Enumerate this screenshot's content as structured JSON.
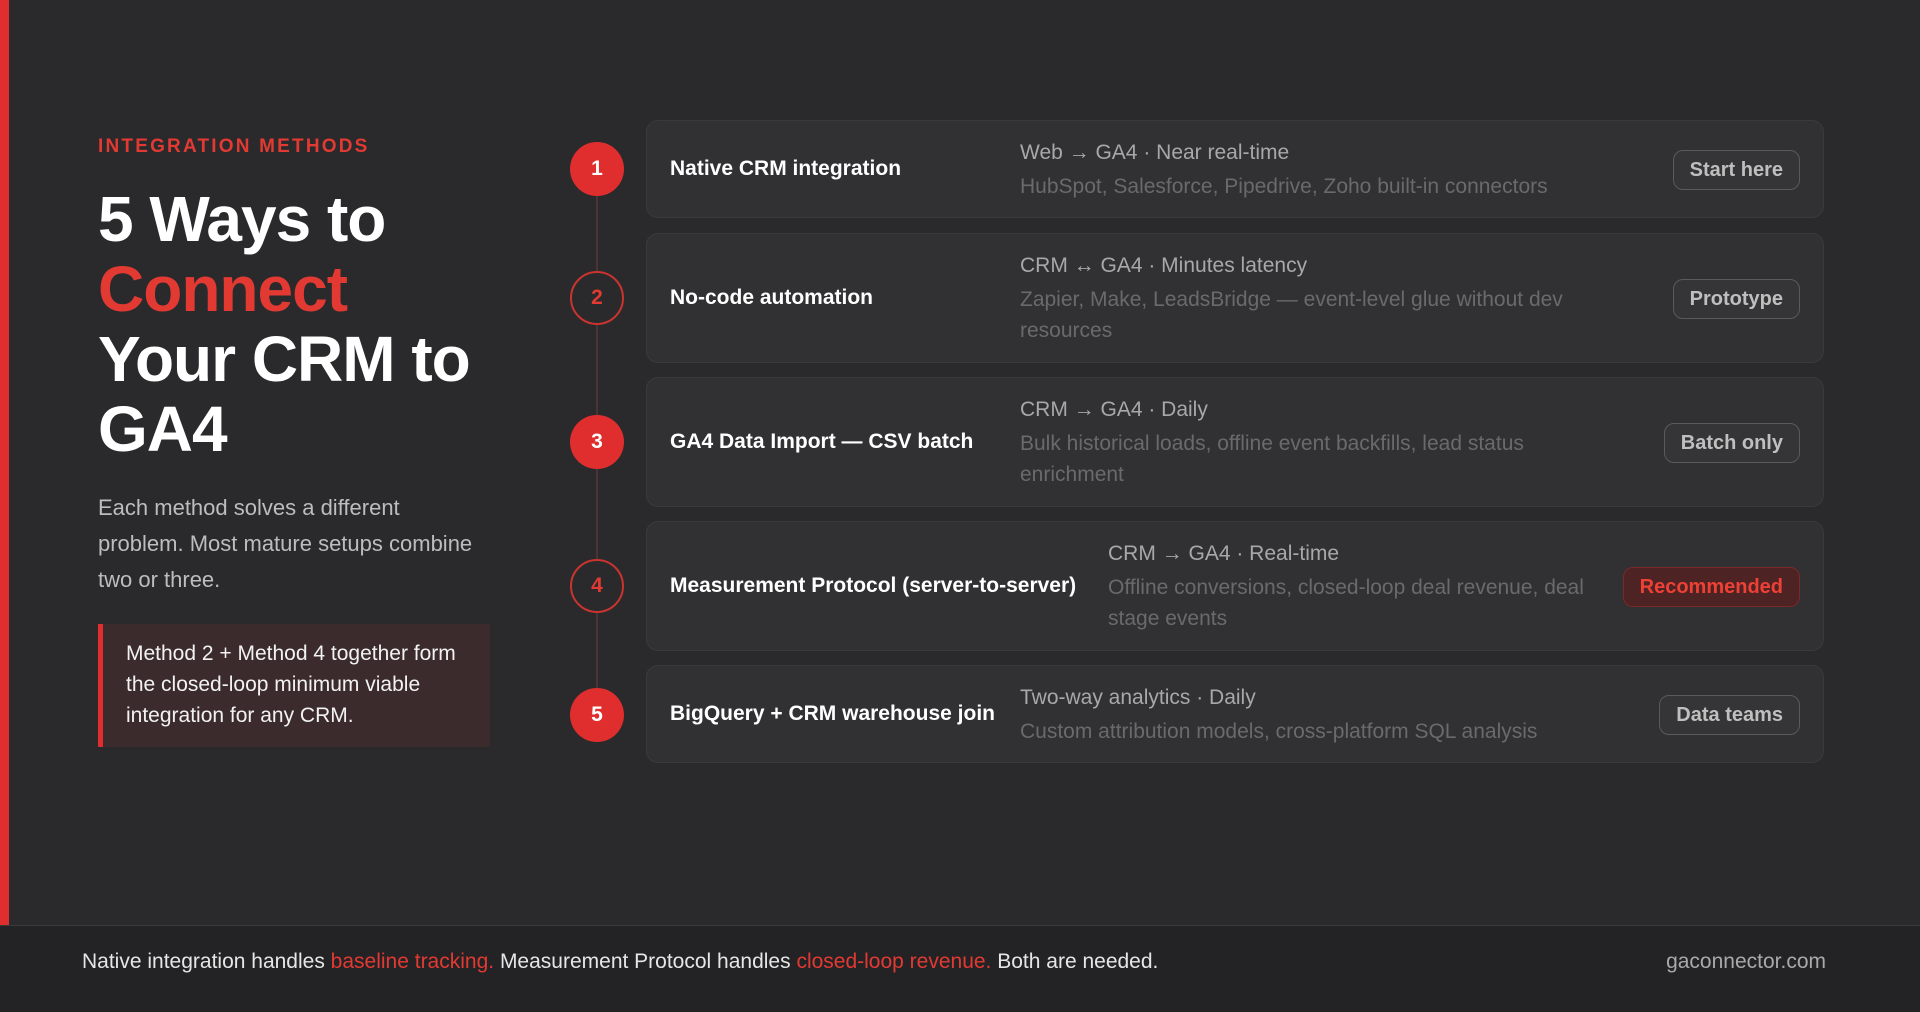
{
  "theme": {
    "accent": "#e02e2e",
    "background": "#2a2a2c",
    "card": "#313133"
  },
  "hero": {
    "eyebrow": "INTEGRATION METHODS",
    "title_line1": "5 Ways to",
    "title_line2": "Connect",
    "title_line3": "Your CRM to",
    "title_line4": "GA4",
    "description": "Each method solves a different problem. Most mature setups combine two or three.",
    "callout": "Method 2 + Method 4 together form the closed-loop minimum viable integration for any CRM."
  },
  "methods": [
    {
      "number": "1",
      "title": "Native CRM integration",
      "meta": "Web → GA4 · Near real-time",
      "description": "HubSpot, Salesforce, Pipedrive, Zoho built-in connectors",
      "tag": "Start here"
    },
    {
      "number": "2",
      "title": "No-code automation",
      "meta": "CRM ↔ GA4 · Minutes latency",
      "description": "Zapier, Make, LeadsBridge — event-level glue without dev resources",
      "tag": "Prototype"
    },
    {
      "number": "3",
      "title": "GA4 Data Import — CSV batch",
      "meta": "CRM → GA4 · Daily",
      "description": "Bulk historical loads, offline event backfills, lead status enrichment",
      "tag": "Batch only"
    },
    {
      "number": "4",
      "title": "Measurement Protocol (server-to-server)",
      "meta": "CRM → GA4 · Real-time",
      "description": "Offline conversions, closed-loop deal revenue, deal stage events",
      "tag": "Recommended"
    },
    {
      "number": "5",
      "title": "BigQuery + CRM warehouse join",
      "meta": "Two-way analytics · Daily",
      "description": "Custom attribution models, cross-platform SQL analysis",
      "tag": "Data teams"
    }
  ],
  "footer": {
    "part1": "Native integration handles ",
    "highlight1": "baseline tracking.",
    "part2": " Measurement Protocol handles ",
    "highlight2": "closed-loop revenue.",
    "part3": " Both are needed.",
    "domain": "gaconnector.com"
  }
}
